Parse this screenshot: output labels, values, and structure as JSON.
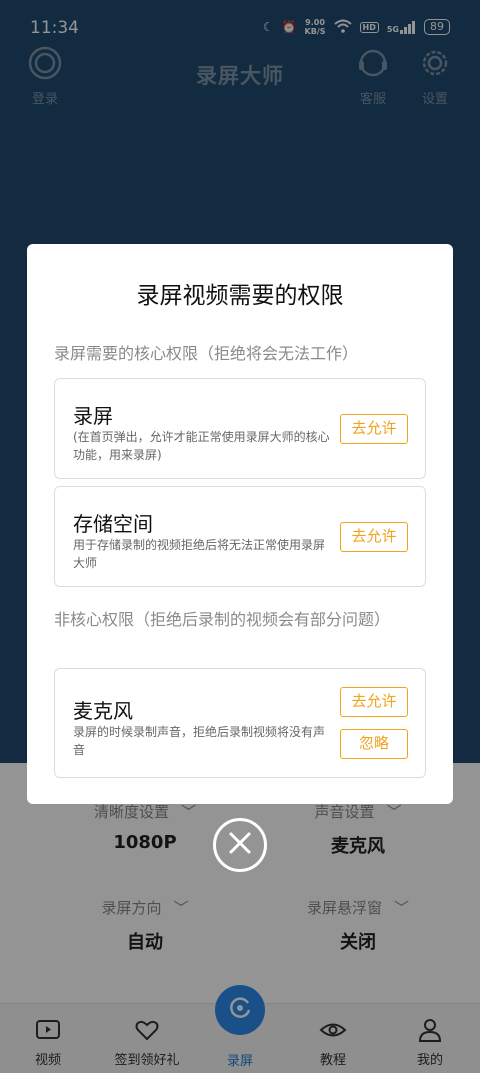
{
  "status_bar": {
    "time": "11:34",
    "net_speed_value": "9.00",
    "net_speed_unit": "KB/S",
    "hd": "HD",
    "signal": "5G",
    "battery": "89"
  },
  "header": {
    "login_label": "登录",
    "title": "录屏大师",
    "service_label": "客服",
    "settings_label": "设置"
  },
  "settings": [
    {
      "label": "清晰度设置",
      "value": "1080P"
    },
    {
      "label": "声音设置",
      "value": "麦克风"
    },
    {
      "label": "录屏方向",
      "value": "自动"
    },
    {
      "label": "录屏悬浮窗",
      "value": "关闭"
    }
  ],
  "tabbar": {
    "tabs": [
      {
        "label": "视频"
      },
      {
        "label": "签到领好礼"
      },
      {
        "label": "录屏"
      },
      {
        "label": "教程"
      },
      {
        "label": "我的"
      }
    ]
  },
  "dialog": {
    "title": "录屏视频需要的权限",
    "core_section": "录屏需要的核心权限（拒绝将会无法工作）",
    "noncore_section": "非核心权限（拒绝后录制的视频会有部分问题）",
    "permissions": [
      {
        "name": "录屏",
        "desc": "(在首页弹出，允许才能正常使用录屏大师的核心功能，用来录屏)",
        "allow": "去允许"
      },
      {
        "name": "存储空间",
        "desc": "用于存储录制的视频拒绝后将无法正常使用录屏大师",
        "allow": "去允许"
      },
      {
        "name": "麦克风",
        "desc": "录屏的时候录制声音，拒绝后录制视频将没有声音",
        "allow": "去允许",
        "ignore": "忽略"
      }
    ]
  },
  "colors": {
    "header_bg": "#1f4b70",
    "accent_orange": "#f2a31c",
    "tab_active": "#1e7ad6"
  }
}
